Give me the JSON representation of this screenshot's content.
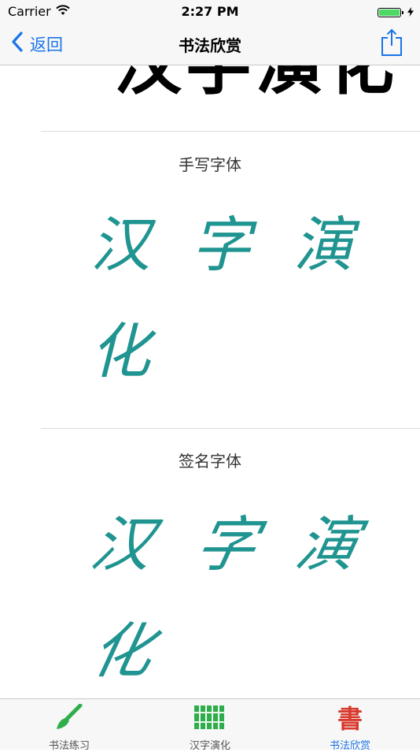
{
  "status_bar": {
    "carrier": "Carrier",
    "time": "2:27 PM",
    "wifi_icon": "wifi-icon",
    "battery_icon": "battery-icon",
    "charging_icon": "bolt-icon"
  },
  "nav": {
    "back_label": "返回",
    "title": "书法欣赏",
    "share_icon": "share-icon",
    "accent_color": "#1a74e8"
  },
  "top_section": {
    "chars": [
      "汉",
      "字",
      "演",
      "化"
    ]
  },
  "sections": [
    {
      "title": "手写字体",
      "chars": [
        "汉",
        "字",
        "演",
        "化"
      ]
    },
    {
      "title": "签名字体",
      "chars": [
        "汉",
        "字",
        "演",
        "化"
      ]
    }
  ],
  "calligraphy_color": "#1f9490",
  "tabs": [
    {
      "label": "书法练习",
      "icon": "brush-icon",
      "active": false
    },
    {
      "label": "汉字演化",
      "icon": "bamboo-slips-icon",
      "active": false
    },
    {
      "label": "书法欣赏",
      "icon": "shu-character-icon",
      "active": true
    }
  ]
}
